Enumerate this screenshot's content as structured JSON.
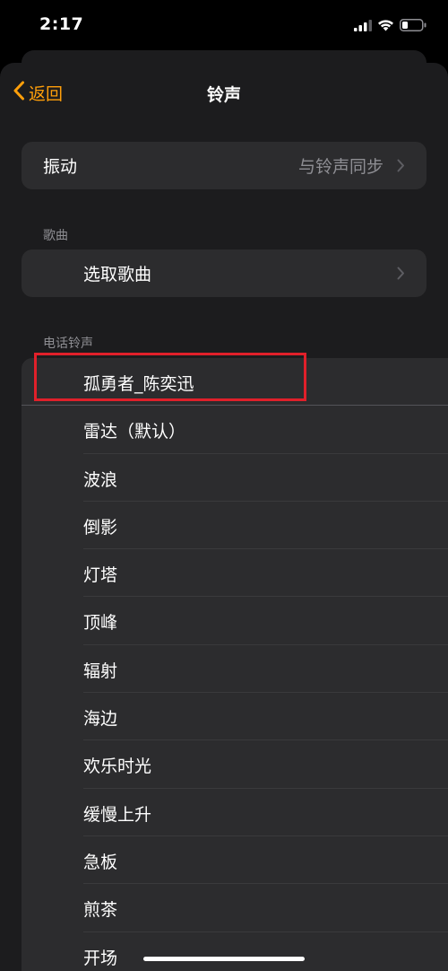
{
  "status_bar": {
    "time": "2:17"
  },
  "nav": {
    "back_label": "返回",
    "title": "铃声"
  },
  "vibration": {
    "label": "振动",
    "value": "与铃声同步"
  },
  "songs_section": {
    "header": "歌曲",
    "pick_label": "选取歌曲"
  },
  "ringtones_section": {
    "header": "电话铃声",
    "items": [
      "孤勇者_陈奕迅",
      "雷达（默认）",
      "波浪",
      "倒影",
      "灯塔",
      "顶峰",
      "辐射",
      "海边",
      "欢乐时光",
      "缓慢上升",
      "急板",
      "煎茶",
      "开场"
    ]
  },
  "colors": {
    "accent": "#ff9f0a",
    "background": "#000000",
    "sheet": "#1c1c1e",
    "cell": "#2c2c2e",
    "secondary_text": "#8e8e93",
    "highlight": "#e0202a"
  }
}
